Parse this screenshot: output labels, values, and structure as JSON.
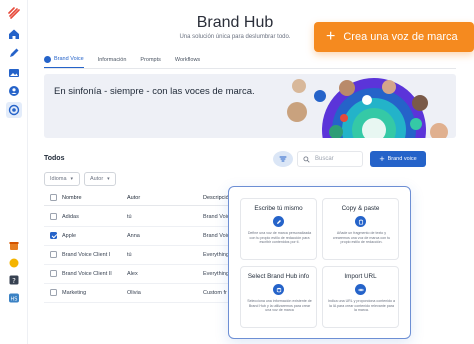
{
  "app": {
    "title": "Brand Hub",
    "subtitle": "Una solución única para deslumbrar todo."
  },
  "cta": {
    "label": "Crea una voz de marca"
  },
  "tabs": [
    {
      "label": "Brand Voice",
      "active": true
    },
    {
      "label": "Información",
      "active": false
    },
    {
      "label": "Prompts",
      "active": false
    },
    {
      "label": "Workflows",
      "active": false
    }
  ],
  "banner": {
    "text": "En sinfonía - siempre - con las voces de marca."
  },
  "list": {
    "heading": "Todos",
    "search_placeholder": "Buscar",
    "add_button": "Brand voice",
    "filters": [
      {
        "label": "Idioma"
      },
      {
        "label": "Autor"
      }
    ],
    "columns": {
      "name": "Nombre",
      "author": "Autor",
      "desc": "Descripción"
    },
    "rows": [
      {
        "name": "Adidas",
        "author": "tú",
        "desc": "Brand Voice",
        "checked": false
      },
      {
        "name": "Apple",
        "author": "Anna",
        "desc": "Brand Voice",
        "checked": true
      },
      {
        "name": "Brand Voice Client I",
        "author": "tú",
        "desc": "Everything",
        "checked": false
      },
      {
        "name": "Brand Voice Client II",
        "author": "Alex",
        "desc": "Everything",
        "checked": false
      },
      {
        "name": "Marketing",
        "author": "Olivia",
        "desc": "Custom fr",
        "checked": false
      }
    ]
  },
  "popup": {
    "cards": [
      {
        "title": "Escribe tú mismo",
        "icon": "pencil-icon",
        "desc": "Define una voz de marca personalizada con tu propio estilo de redacción para escribir contenidos por ti."
      },
      {
        "title": "Copy & paste",
        "icon": "paste-icon",
        "desc": "Añade un fragmento de texto y crearemos una voz de marca con tu propio estilo de redacción."
      },
      {
        "title": "Select Brand Hub info",
        "icon": "database-icon",
        "desc": "Selecciona una información existente de Brand Hub y la utilizaremos para crear una voz de marca"
      },
      {
        "title": "Import URL",
        "icon": "link-icon",
        "desc": "Indica una URL y proporciona contenido a la IA para crear contenido relevante para la marca."
      }
    ]
  },
  "colors": {
    "accent": "#2563c9",
    "cta": "#f58a1f",
    "popup_border": "#6d8fd4"
  }
}
